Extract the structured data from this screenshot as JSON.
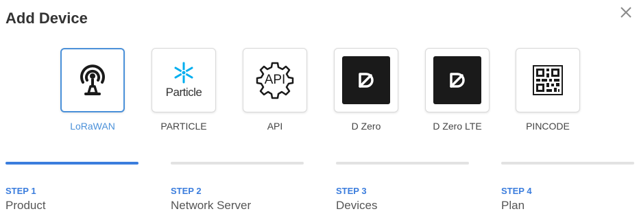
{
  "dialog": {
    "title": "Add Device",
    "close_icon": "close-icon"
  },
  "colors": {
    "accent": "#3b7ddd",
    "selected_border": "#4a90d9",
    "inactive_bar": "#e2e2e2",
    "dark_tile": "#1a1a1a",
    "particle_blue": "#00aeef"
  },
  "products": [
    {
      "label": "LoRaWAN",
      "icon": "antenna-icon",
      "selected": true
    },
    {
      "label": "PARTICLE",
      "icon": "particle-logo-icon",
      "logo_text": "Particle",
      "selected": false
    },
    {
      "label": "API",
      "icon": "api-gear-icon",
      "icon_text": "API",
      "selected": false
    },
    {
      "label": "D Zero",
      "icon": "dzero-logo-icon",
      "selected": false
    },
    {
      "label": "D Zero LTE",
      "icon": "dzero-logo-icon",
      "selected": false
    },
    {
      "label": "PINCODE",
      "icon": "qr-code-icon",
      "selected": false
    }
  ],
  "steps": [
    {
      "number": "STEP 1",
      "name": "Product",
      "active": true
    },
    {
      "number": "STEP 2",
      "name": "Network Server",
      "active": false
    },
    {
      "number": "STEP 3",
      "name": "Devices",
      "active": false
    },
    {
      "number": "STEP 4",
      "name": "Plan",
      "active": false
    }
  ]
}
